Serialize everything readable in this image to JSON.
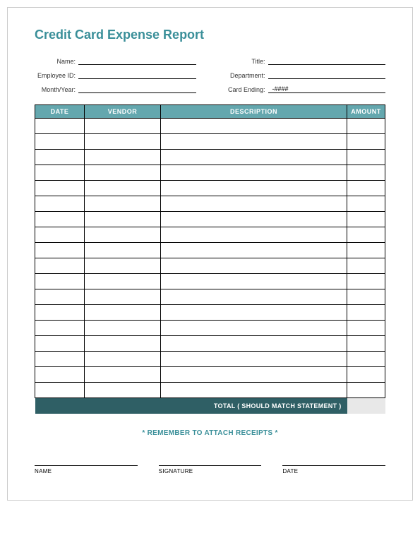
{
  "title": "Credit Card Expense Report",
  "fields": {
    "left": [
      {
        "label": "Name:",
        "value": ""
      },
      {
        "label": "Employee ID:",
        "value": ""
      },
      {
        "label": "Month/Year:",
        "value": ""
      }
    ],
    "right": [
      {
        "label": "Title:",
        "value": ""
      },
      {
        "label": "Department:",
        "value": ""
      },
      {
        "label": "Card Ending:",
        "value": "-####"
      }
    ]
  },
  "table": {
    "headers": [
      "DATE",
      "VENDOR",
      "DESCRIPTION",
      "AMOUNT"
    ],
    "rows": [
      [
        "",
        "",
        "",
        ""
      ],
      [
        "",
        "",
        "",
        ""
      ],
      [
        "",
        "",
        "",
        ""
      ],
      [
        "",
        "",
        "",
        ""
      ],
      [
        "",
        "",
        "",
        ""
      ],
      [
        "",
        "",
        "",
        ""
      ],
      [
        "",
        "",
        "",
        ""
      ],
      [
        "",
        "",
        "",
        ""
      ],
      [
        "",
        "",
        "",
        ""
      ],
      [
        "",
        "",
        "",
        ""
      ],
      [
        "",
        "",
        "",
        ""
      ],
      [
        "",
        "",
        "",
        ""
      ],
      [
        "",
        "",
        "",
        ""
      ],
      [
        "",
        "",
        "",
        ""
      ],
      [
        "",
        "",
        "",
        ""
      ],
      [
        "",
        "",
        "",
        ""
      ],
      [
        "",
        "",
        "",
        ""
      ],
      [
        "",
        "",
        "",
        ""
      ]
    ],
    "total_label": "TOTAL ( SHOULD MATCH STATEMENT )",
    "total_value": ""
  },
  "reminder": "* REMEMBER TO ATTACH RECEIPTS *",
  "signatures": [
    "NAME",
    "SIGNATURE",
    "DATE"
  ]
}
